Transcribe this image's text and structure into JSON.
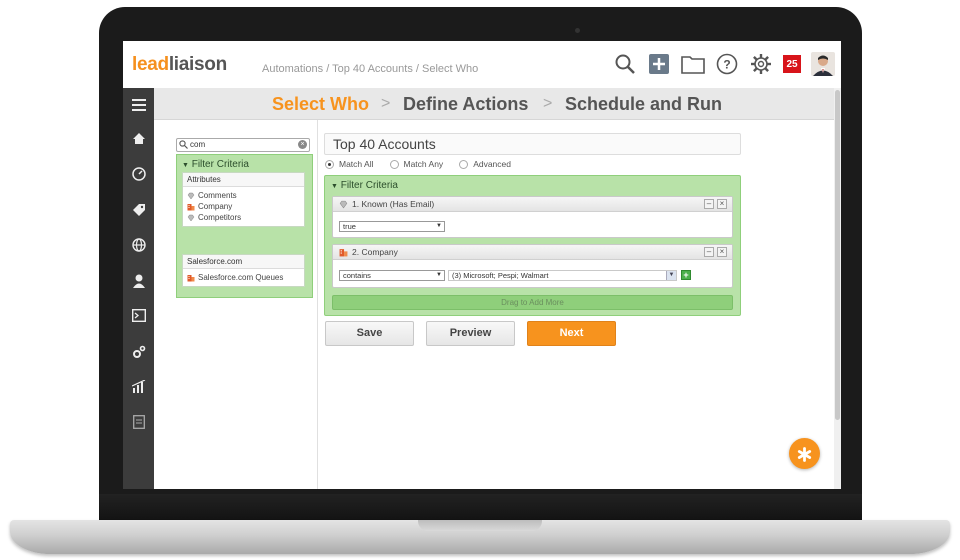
{
  "logo": {
    "part1": "lead",
    "part2": "liaison"
  },
  "breadcrumb": "Automations / Top 40 Accounts / Select Who",
  "header_icons": [
    "search-icon",
    "add-icon",
    "folder-icon",
    "help-icon",
    "gear-icon"
  ],
  "notification_count": "25",
  "sidebar_icons": [
    "menu-icon",
    "home-icon",
    "dashboard-icon",
    "tag-icon",
    "globe-icon",
    "user-icon",
    "terminal-icon",
    "settings-icon",
    "chart-icon",
    "report-icon"
  ],
  "wizard": {
    "steps": [
      "Select Who",
      "Define Actions",
      "Schedule and Run"
    ],
    "active_color": "#f7931e"
  },
  "left_panel": {
    "search_value": "com",
    "filter_criteria_label": "Filter Criteria",
    "groups": [
      {
        "title": "Attributes",
        "items": [
          {
            "icon": "gem-icon",
            "label": "Comments"
          },
          {
            "icon": "building-icon",
            "label": "Company"
          },
          {
            "icon": "gem-icon",
            "label": "Competitors"
          }
        ]
      },
      {
        "title": "Salesforce.com",
        "items": [
          {
            "icon": "building-icon",
            "label": "Salesforce.com Queues"
          }
        ]
      }
    ]
  },
  "main": {
    "title_value": "Top 40 Accounts",
    "match_options": [
      "Match All",
      "Match Any",
      "Advanced"
    ],
    "selected_match": "Match All",
    "criteria_label": "Filter Criteria",
    "criteria": [
      {
        "title": "1. Known (Has Email)",
        "icon": "gem-icon",
        "operator": "true"
      },
      {
        "title": "2. Company",
        "icon": "building-icon",
        "operator": "contains",
        "value": "(3) Microsoft; Pespi; Walmart"
      }
    ],
    "drag_label": "Drag to Add More",
    "buttons": {
      "save": "Save",
      "preview": "Preview",
      "next": "Next"
    }
  },
  "colors": {
    "accent": "#f7931e",
    "green_panel": "#b8e2a8",
    "sidebar": "#3c3c3c"
  }
}
